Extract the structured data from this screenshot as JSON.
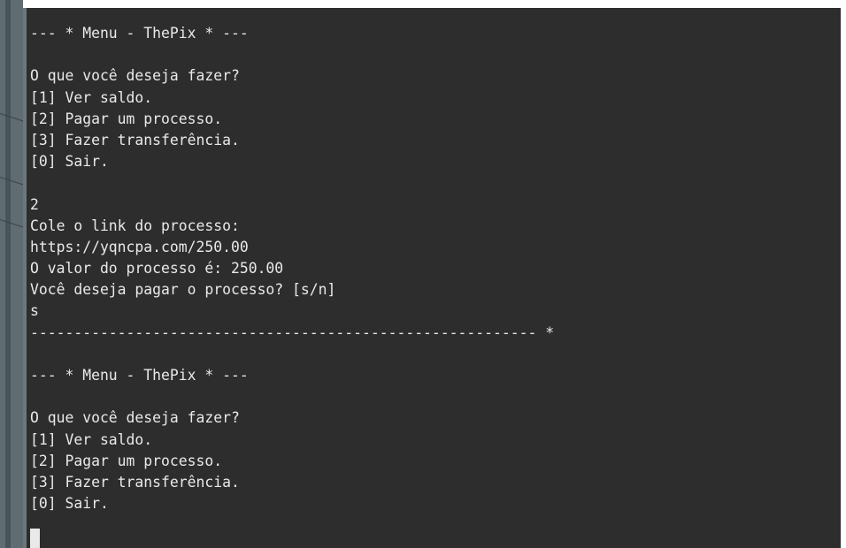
{
  "terminal": {
    "lines": [
      "--- * Menu - ThePix * ---",
      "",
      "O que você deseja fazer?",
      "[1] Ver saldo.",
      "[2] Pagar um processo.",
      "[3] Fazer transferência.",
      "[0] Sair.",
      "",
      "2",
      "Cole o link do processo:",
      "https://yqncpa.com/250.00",
      "O valor do processo é: 250.00",
      "Você deseja pagar o processo? [s/n]",
      "s",
      "---------------------------------------------------------- *",
      "",
      "--- * Menu - ThePix * ---",
      "",
      "O que você deseja fazer?",
      "[1] Ver saldo.",
      "[2] Pagar um processo.",
      "[3] Fazer transferência.",
      "[0] Sair."
    ]
  },
  "colors": {
    "terminal_background": "#2d2d2d",
    "terminal_text": "#e9e9e9",
    "sidebar": "#5f6c72"
  }
}
